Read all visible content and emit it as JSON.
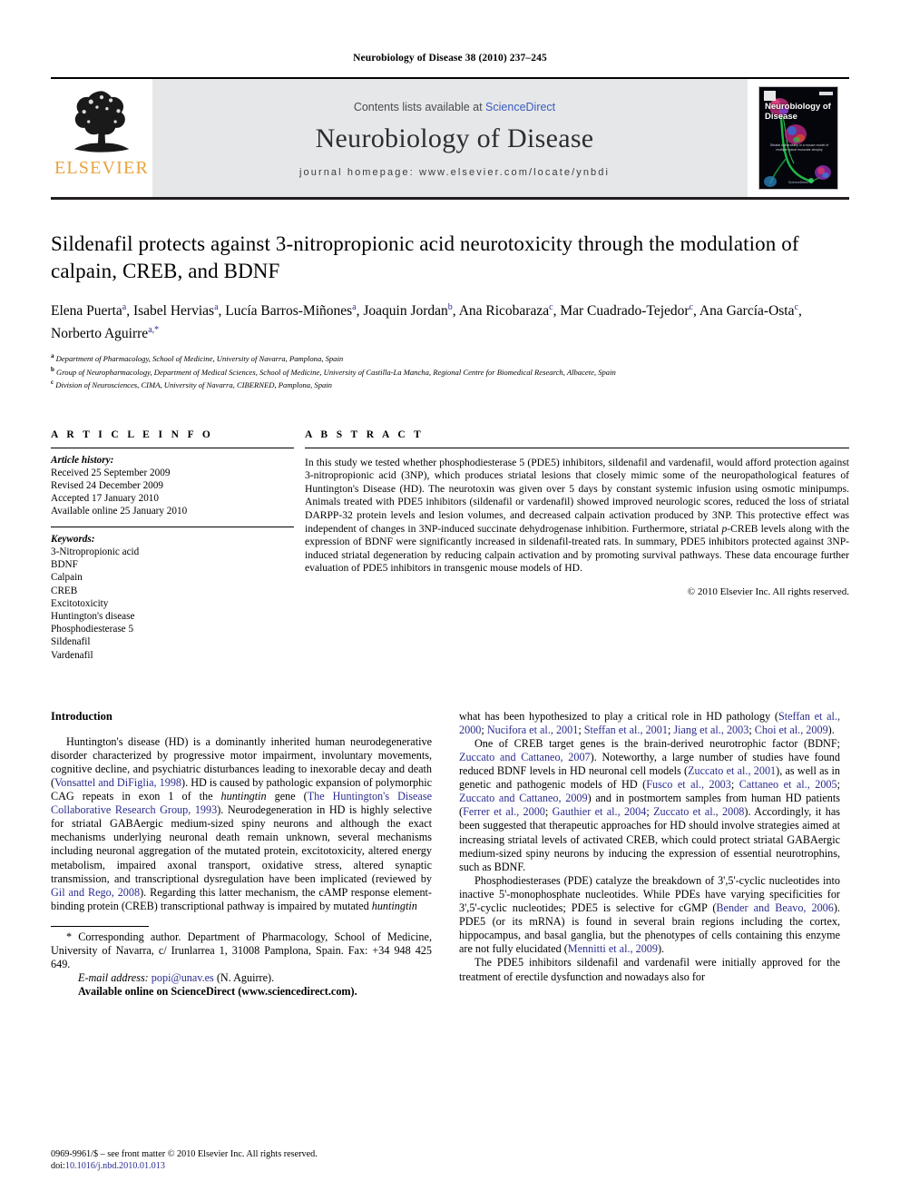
{
  "running_head": "Neurobiology of Disease 38 (2010) 237–245",
  "masthead": {
    "publisher_name": "ELSEVIER",
    "contents_prefix": "Contents lists available at ",
    "contents_link": "ScienceDirect",
    "journal_title": "Neurobiology of Disease",
    "homepage": "journal homepage: www.elsevier.com/locate/ynbdi",
    "cover": {
      "title": "Neurobiology of Disease",
      "subtitle": "Striatal vulnerability in a mouse model of multiple spinal muscular atrophy",
      "footer": "ScienceDirect"
    }
  },
  "article": {
    "title": "Sildenafil protects against 3-nitropropionic acid neurotoxicity through the modulation of calpain, CREB, and BDNF",
    "authors": [
      {
        "name": "Elena Puerta",
        "marks": "a"
      },
      {
        "name": "Isabel Hervias",
        "marks": "a"
      },
      {
        "name": "Lucía Barros-Miñones",
        "marks": "a"
      },
      {
        "name": "Joaquin Jordan",
        "marks": "b"
      },
      {
        "name": "Ana Ricobaraza",
        "marks": "c"
      },
      {
        "name": "Mar Cuadrado-Tejedor",
        "marks": "c"
      },
      {
        "name": "Ana García-Osta",
        "marks": "c"
      },
      {
        "name": "Norberto Aguirre",
        "marks": "a,*"
      }
    ],
    "affiliations": [
      {
        "mark": "a",
        "text": "Department of Pharmacology, School of Medicine, University of Navarra, Pamplona, Spain"
      },
      {
        "mark": "b",
        "text": "Group of Neuropharmacology, Department of Medical Sciences, School of Medicine, University of Castilla-La Mancha, Regional Centre for Biomedical Research, Albacete, Spain"
      },
      {
        "mark": "c",
        "text": "Division of Neurosciences, CIMA, University of Navarra, CIBERNED, Pamplona, Spain"
      }
    ]
  },
  "article_info": {
    "heading": "A R T I C L E    I N F O",
    "history_label": "Article history:",
    "history": [
      "Received 25 September 2009",
      "Revised 24 December 2009",
      "Accepted 17 January 2010",
      "Available online 25 January 2010"
    ],
    "keywords_label": "Keywords:",
    "keywords": [
      "3-Nitropropionic acid",
      "BDNF",
      "Calpain",
      "CREB",
      "Excitotoxicity",
      "Huntington's disease",
      "Phosphodiesterase 5",
      "Sildenafil",
      "Vardenafil"
    ]
  },
  "abstract": {
    "heading": "A B S T R A C T",
    "text": "In this study we tested whether phosphodiesterase 5 (PDE5) inhibitors, sildenafil and vardenafil, would afford protection against 3-nitropropionic acid (3NP), which produces striatal lesions that closely mimic some of the neuropathological features of Huntington's Disease (HD). The neurotoxin was given over 5 days by constant systemic infusion using osmotic minipumps. Animals treated with PDE5 inhibitors (sildenafil or vardenafil) showed improved neurologic scores, reduced the loss of striatal DARPP-32 protein levels and lesion volumes, and decreased calpain activation produced by 3NP. This protective effect was independent of changes in 3NP-induced succinate dehydrogenase inhibition. Furthermore, striatal p-CREB levels along with the expression of BDNF were significantly increased in sildenafil-treated rats. In summary, PDE5 inhibitors protected against 3NP-induced striatal degeneration by reducing calpain activation and by promoting survival pathways. These data encourage further evaluation of PDE5 inhibitors in transgenic mouse models of HD.",
    "copyright": "© 2010 Elsevier Inc. All rights reserved."
  },
  "body": {
    "intro_heading": "Introduction",
    "left_paragraphs": [
      "Huntington's disease (HD) is a dominantly inherited human neurodegenerative disorder characterized by progressive motor impairment, involuntary movements, cognitive decline, and psychiatric disturbances leading to inexorable decay and death (Vonsattel and DiFiglia, 1998). HD is caused by pathologic expansion of polymorphic CAG repeats in exon 1 of the huntingtin gene (The Huntington's Disease Collaborative Research Group, 1993). Neurodegeneration in HD is highly selective for striatal GABAergic medium-sized spiny neurons and although the exact mechanisms underlying neuronal death remain unknown, several mechanisms including neuronal aggregation of the mutated protein, excitotoxicity, altered energy metabolism, impaired axonal transport, oxidative stress, altered synaptic transmission, and transcriptional dysregulation have been implicated (reviewed by Gil and Rego, 2008). Regarding this latter mechanism, the cAMP response element-binding protein (CREB) transcriptional pathway is impaired by mutated huntingtin"
    ],
    "right_paragraphs": [
      "what has been hypothesized to play a critical role in HD pathology (Steffan et al., 2000; Nucifora et al., 2001; Steffan et al., 2001; Jiang et al., 2003; Choi et al., 2009).",
      "One of CREB target genes is the brain-derived neurotrophic factor (BDNF; Zuccato and Cattaneo, 2007). Noteworthy, a large number of studies have found reduced BDNF levels in HD neuronal cell models (Zuccato et al., 2001), as well as in genetic and pathogenic models of HD (Fusco et al., 2003; Cattaneo et al., 2005; Zuccato and Cattaneo, 2009) and in postmortem samples from human HD patients (Ferrer et al., 2000; Gauthier et al., 2004; Zuccato et al., 2008). Accordingly, it has been suggested that therapeutic approaches for HD should involve strategies aimed at increasing striatal levels of activated CREB, which could protect striatal GABAergic medium-sized spiny neurons by inducing the expression of essential neurotrophins, such as BDNF.",
      "Phosphodiesterases (PDE) catalyze the breakdown of 3',5'-cyclic nucleotides into inactive 5'-monophosphate nucleotides. While PDEs have varying specificities for 3',5'-cyclic nucleotides; PDE5 is selective for cGMP (Bender and Beavo, 2006). PDE5 (or its mRNA) is found in several brain regions including the cortex, hippocampus, and basal ganglia, but the phenotypes of cells containing this enzyme are not fully elucidated (Mennitti et al., 2009).",
      "The PDE5 inhibitors sildenafil and vardenafil were initially approved for the treatment of erectile dysfunction and nowadays also for"
    ]
  },
  "footnotes": {
    "corresponding": "* Corresponding author. Department of Pharmacology, School of Medicine, University of Navarra, c/ Irunlarrea 1, 31008 Pamplona, Spain. Fax: +34 948 425 649.",
    "email_label": "E-mail address:",
    "email": "popi@unav.es",
    "email_suffix": " (N. Aguirre).",
    "available_online": "Available online on ScienceDirect (www.sciencedirect.com)."
  },
  "imprint": {
    "front_matter": "0969-9961/$ – see front matter © 2010 Elsevier Inc. All rights reserved.",
    "doi_label": "doi:",
    "doi": "10.1016/j.nbd.2010.01.013"
  },
  "colors": {
    "link": "#2b2d8e",
    "sciencedirect": "#3b5bbf",
    "elsevier_orange": "#e8a33d",
    "masthead_bg": "#e6e7e9"
  }
}
